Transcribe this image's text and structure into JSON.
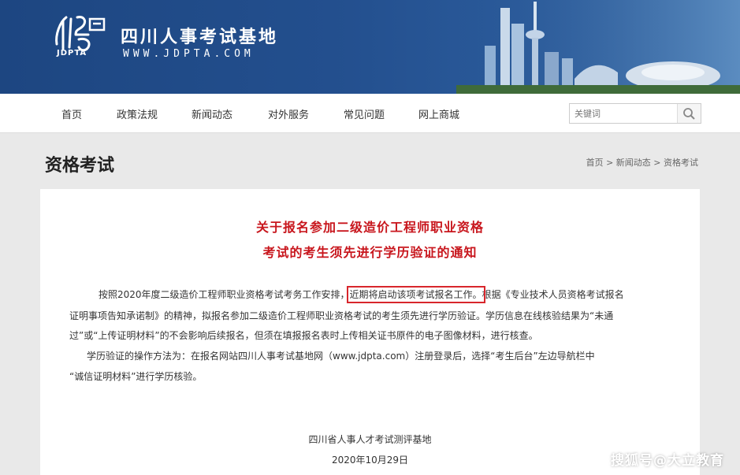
{
  "header": {
    "logo_text": "JDPTA",
    "site_name": "四川人事考试基地",
    "site_url": "WWW.JDPTA.COM"
  },
  "nav": {
    "items": [
      "首页",
      "政策法规",
      "新闻动态",
      "对外服务",
      "常见问题",
      "网上商城"
    ],
    "search_placeholder": "关键词"
  },
  "section": {
    "title": "资格考试",
    "breadcrumb": [
      "首页",
      "新闻动态",
      "资格考试"
    ],
    "separator": ">"
  },
  "article": {
    "title_line1": "关于报名参加二级造价工程师职业资格",
    "title_line2": "考试的考生须先进行学历验证的通知",
    "p1_line1_a": "按照2020年度二级造价工程师职业资格考试考务工作安排，",
    "p1_line1_highlight": "近期将启动该项考试报名工作。",
    "p1_line1_b": "根据《专业技术人员资格考试报名",
    "p1_line2": "证明事项告知承诺制》的精神，拟报名参加二级造价工程师职业资格考试的考生须先进行学历验证。学历信息在线核验结果为“未通",
    "p1_line3": "过”或“上传证明材料”的不会影响后续报名，但须在填报报名表时上传相关证书原件的电子图像材料，进行核查。",
    "p2_line1": "学历验证的操作方法为：在报名网站四川人事考试基地网（www.jdpta.com）注册登录后，选择“考生后台”左边导航栏中",
    "p2_line2": "“诚信证明材料”进行学历核验。",
    "signature": "四川省人事人才考试测评基地",
    "date": "2020年10月29日"
  },
  "watermark": "搜狐号@大立教育",
  "colors": {
    "banner": "#1f4a87",
    "title_red": "#c8161d",
    "highlight_box": "#d8262c"
  }
}
